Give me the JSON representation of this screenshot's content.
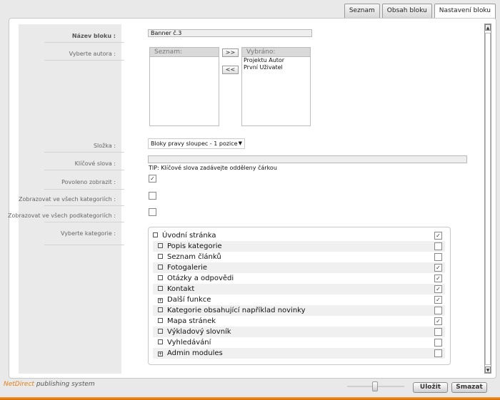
{
  "tabs": [
    {
      "label": "Seznam"
    },
    {
      "label": "Obsah bloku"
    },
    {
      "label": "Nastavení bloku"
    }
  ],
  "form": {
    "nazev_label": "Název bloku :",
    "nazev_value": "Banner č.3",
    "autor_label": "Vyberte autora :",
    "seznam_head": "Seznam:",
    "vybrano_head": "Vybráno:",
    "vybrano_items": [
      "Projektu Autor",
      "První Uživatel"
    ],
    "add_btn": ">>",
    "remove_btn": "<<",
    "slozka_label": "Složka :",
    "slozka_value": "Bloky pravy sloupec - 1 pozice",
    "klicova_label": "Klíčové slova :",
    "klicova_value": "",
    "tip": "TIP: Klíčové slova zadávejte odděleny čárkou",
    "povoleno_label": "Povoleno zobrazit :",
    "povoleno_checked": true,
    "vsech_kat_label": "Zobrazovat ve všech kategoriích :",
    "vsech_kat_checked": false,
    "vsech_podkat_label": "Zobrazovat ve všech podkategoriích :",
    "vsech_podkat_checked": false,
    "kategorie_label": "Vyberte kategorie :"
  },
  "categories": [
    {
      "name": "Úvodní stránka",
      "mark": "",
      "checked": true
    },
    {
      "name": "Popis kategorie",
      "mark": "",
      "checked": false
    },
    {
      "name": "Seznam článků",
      "mark": "",
      "checked": false
    },
    {
      "name": "Fotogalerie",
      "mark": "",
      "checked": true
    },
    {
      "name": "Otázky a odpovědi",
      "mark": "",
      "checked": true
    },
    {
      "name": "Kontakt",
      "mark": "",
      "checked": true
    },
    {
      "name": "Další funkce",
      "mark": "+",
      "checked": true
    },
    {
      "name": "Kategorie obsahující například novinky",
      "mark": "",
      "checked": false
    },
    {
      "name": "Mapa stránek",
      "mark": "",
      "checked": true
    },
    {
      "name": "Výkladový slovník",
      "mark": "",
      "checked": false
    },
    {
      "name": "Vyhledávání",
      "mark": "",
      "checked": false
    },
    {
      "name": "Admin modules",
      "mark": "+",
      "checked": false
    }
  ],
  "footer": {
    "brand_nd": "NetDirect",
    "brand_rest": " publishing system",
    "save_label": "Uložit",
    "delete_label": "Smazat"
  },
  "colors": {
    "accent": "#e07e18"
  }
}
